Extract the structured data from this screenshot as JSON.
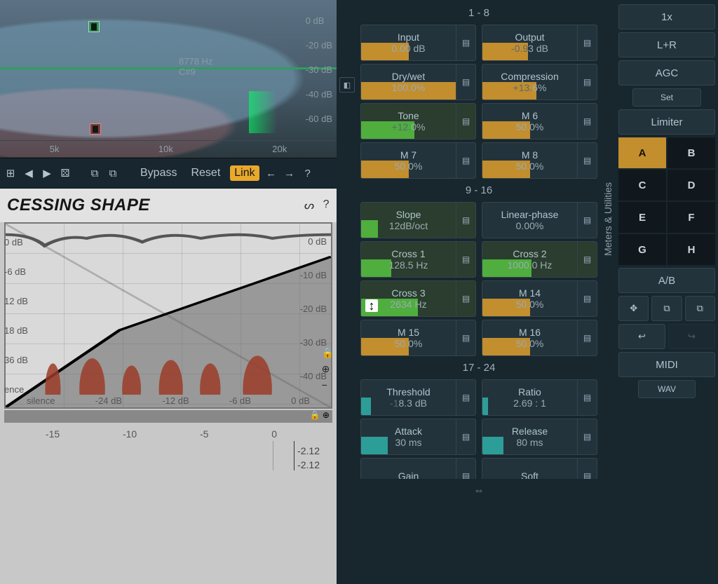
{
  "eq": {
    "readout_hz": "8778 Hz",
    "readout_note": "C#9",
    "db_labels": [
      "0 dB",
      "-20 dB",
      "-30 dB",
      "-40 dB",
      "-60 dB"
    ],
    "x_labels": [
      "5k",
      "10k",
      "20k"
    ]
  },
  "toolbar": {
    "bypass": "Bypass",
    "reset": "Reset",
    "link": "Link"
  },
  "shape": {
    "title": "CESSING SHAPE",
    "y_left": [
      "0 dB",
      "-6 dB",
      "12 dB",
      "18 dB",
      "36 dB",
      "ence"
    ],
    "y_right": [
      "0 dB",
      "-10 dB",
      "-20 dB",
      "-30 dB",
      "-40 dB"
    ],
    "x_labels": [
      "silence",
      "-24 dB",
      "-12 dB",
      "-6 dB",
      "0 dB"
    ]
  },
  "mini": {
    "ticks": [
      "-15",
      "-10",
      "-5",
      "0"
    ],
    "val1": "-2.12",
    "val2": "-2.12"
  },
  "groups": {
    "g1": "1 - 8",
    "g2": "9 - 16",
    "g3": "17 - 24"
  },
  "p": {
    "input": {
      "name": "Input",
      "val": "0.00 dB",
      "fill": 50,
      "color": "orange"
    },
    "output": {
      "name": "Output",
      "val": "-0.93 dB",
      "fill": 48,
      "color": "orange",
      "alt": "-0.9"
    },
    "drywet": {
      "name": "Dry/wet",
      "val": "100.0%",
      "fill": 100,
      "color": "orange"
    },
    "compression": {
      "name": "Compression",
      "val": "+13.6%",
      "fill": 57,
      "color": "orange",
      "alt": "+13."
    },
    "tone": {
      "name": "Tone",
      "val": "+12.0%",
      "fill": 56,
      "color": "green",
      "alt": "+12."
    },
    "m6": {
      "name": "M 6",
      "val": "50.0%",
      "fill": 50,
      "color": "orange"
    },
    "m7": {
      "name": "M 7",
      "val": "50.0%",
      "fill": 50,
      "color": "orange"
    },
    "m8": {
      "name": "M 8",
      "val": "50.0%",
      "fill": 50,
      "color": "orange"
    },
    "slope": {
      "name": "Slope",
      "val": "12dB/oct",
      "fill": 18,
      "color": "green"
    },
    "linphase": {
      "name": "Linear-phase",
      "val": "0.00%",
      "fill": 0,
      "color": "orange"
    },
    "cross1": {
      "name": "Cross 1",
      "val": "128.5 Hz",
      "fill": 32,
      "color": "green"
    },
    "cross2": {
      "name": "Cross 2",
      "val": "1000.0 Hz",
      "fill": 52,
      "color": "green"
    },
    "cross3": {
      "name": "Cross 3",
      "val": "2634 Hz",
      "fill": 60,
      "color": "green"
    },
    "m14": {
      "name": "M 14",
      "val": "50.0%",
      "fill": 50,
      "color": "orange"
    },
    "m15": {
      "name": "M 15",
      "val": "50.0%",
      "fill": 50,
      "color": "orange"
    },
    "m16": {
      "name": "M 16",
      "val": "50.0%",
      "fill": 50,
      "color": "orange"
    },
    "threshold": {
      "name": "Threshold",
      "val": "-18.3 dB",
      "fill": 10,
      "color": "teal",
      "alt": "-1"
    },
    "ratio": {
      "name": "Ratio",
      "val": "2.69 : 1",
      "fill": 6,
      "color": "teal"
    },
    "attack": {
      "name": "Attack",
      "val": "30 ms",
      "fill": 28,
      "color": "teal"
    },
    "release": {
      "name": "Release",
      "val": "80 ms",
      "fill": 22,
      "color": "teal"
    },
    "gain": {
      "name": "Gain",
      "val": "",
      "fill": 0,
      "color": "teal"
    },
    "soft": {
      "name": "Soft",
      "val": "",
      "fill": 0,
      "color": "teal"
    }
  },
  "meters_label": "Meters & Utilities",
  "util": {
    "oversample": "1x",
    "channels": "L+R",
    "agc": "AGC",
    "set": "Set",
    "limiter": "Limiter",
    "presets": [
      "A",
      "B",
      "C",
      "D",
      "E",
      "F",
      "G",
      "H"
    ],
    "ab": "A/B",
    "midi": "MIDI",
    "wav": "WAV"
  }
}
